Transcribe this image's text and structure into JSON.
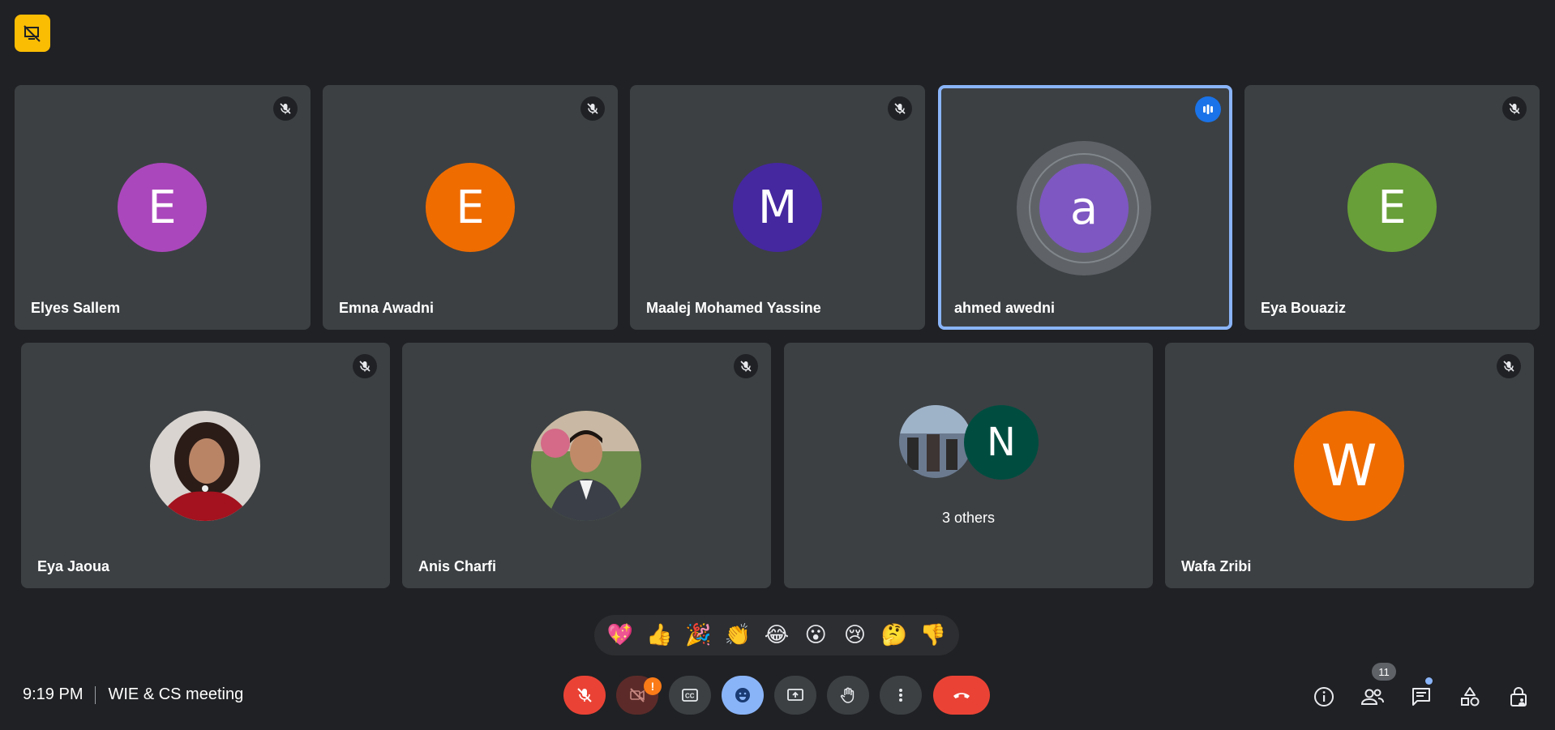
{
  "meeting": {
    "time": "9:19 PM",
    "title": "WIE & CS meeting",
    "participant_count": "11"
  },
  "participants": [
    {
      "name": "Elyes Sallem",
      "initial": "E",
      "color": "#ab47bc",
      "muted": true
    },
    {
      "name": "Emna Awadni",
      "initial": "E",
      "color": "#ef6c00",
      "muted": true
    },
    {
      "name": "Maalej Mohamed Yassine",
      "initial": "M",
      "color": "#4527a0",
      "muted": true
    },
    {
      "name": "ahmed awedni",
      "initial": "a",
      "color": "#7e57c2",
      "muted": false,
      "speaking": true
    },
    {
      "name": "Eya Bouaziz",
      "initial": "E",
      "color": "#689f38",
      "muted": true
    },
    {
      "name": "Eya Jaoua",
      "muted": true
    },
    {
      "name": "Anis Charfi",
      "muted": true
    },
    {
      "name": "Wafa Zribi",
      "initial": "W",
      "color": "#ef6c00",
      "muted": true
    }
  ],
  "others_tile": {
    "label": "3 others",
    "initial": "N",
    "color": "#004d40"
  },
  "reactions": [
    "💖",
    "👍",
    "🎉",
    "👏",
    "😂",
    "😮",
    "😢",
    "🤔",
    "👎"
  ],
  "controls": {
    "mic": {
      "state": "muted",
      "color": "#ea4335"
    },
    "camera": {
      "state": "off",
      "warning": "!"
    },
    "end_call_color": "#ea4335",
    "emoji_active_color": "#8ab4f8"
  }
}
